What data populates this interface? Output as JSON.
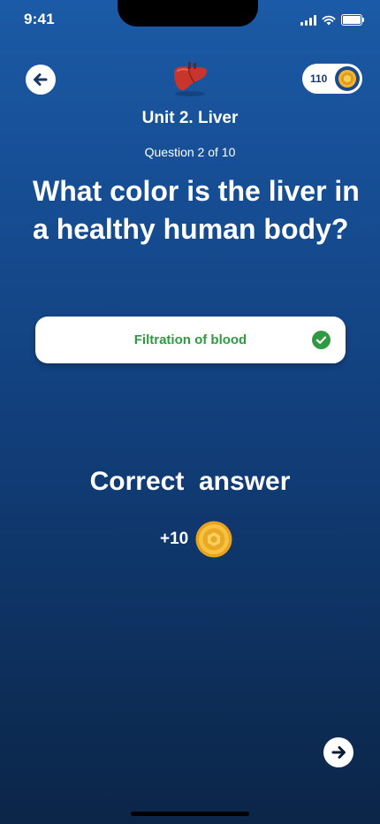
{
  "status_bar": {
    "time": "9:41"
  },
  "header": {
    "coins": "110",
    "unit_title": "Unit 2. Liver",
    "progress": "Question 2 of 10"
  },
  "question": {
    "text": "What color is the liver in a healthy human body?"
  },
  "answer": {
    "label": "Filtration of blood",
    "state": "correct"
  },
  "feedback": {
    "title": "Correct  answer",
    "reward": "+10"
  },
  "icons": {
    "back": "arrow-left-icon",
    "next": "arrow-right-icon",
    "coin": "coin-icon",
    "check": "check-circle-icon",
    "liver": "liver-icon"
  },
  "colors": {
    "background_top": "#1b5aa6",
    "background_bottom": "#0b2547",
    "correct_green": "#2e9a41",
    "coin_gold": "#f2b632",
    "navy": "#1a3566"
  }
}
